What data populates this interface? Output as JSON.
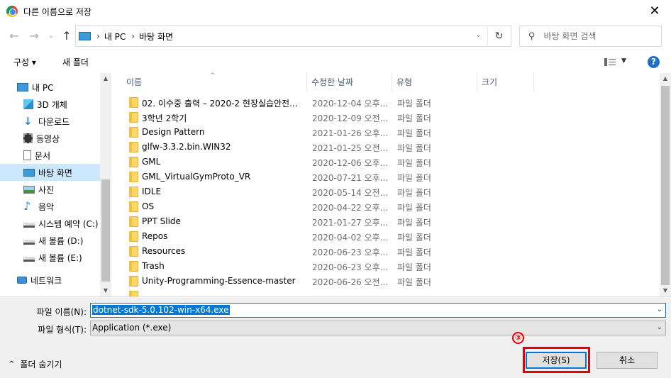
{
  "window": {
    "title": "다른 이름으로 저장",
    "close_glyph": "✕"
  },
  "nav": {
    "back_glyph": "←",
    "forward_glyph": "→",
    "recent_glyph": "⌄",
    "up_glyph": "↑",
    "breadcrumb": [
      "내 PC",
      "바탕 화면"
    ],
    "refresh_glyph": "↻",
    "search_placeholder": "바탕 화면 검색"
  },
  "toolbar": {
    "organize_label": "구성 ▾",
    "new_folder_label": "새 폴더",
    "help_label": "?"
  },
  "sidebar": {
    "items": [
      {
        "label": "내 PC",
        "icon": "pc-icon"
      },
      {
        "label": "3D 개체",
        "icon": "3d-objects-icon"
      },
      {
        "label": "다운로드",
        "icon": "download-icon"
      },
      {
        "label": "동영상",
        "icon": "video-icon"
      },
      {
        "label": "문서",
        "icon": "document-icon"
      },
      {
        "label": "바탕 화면",
        "icon": "desktop-icon",
        "selected": true
      },
      {
        "label": "사진",
        "icon": "pictures-icon"
      },
      {
        "label": "음악",
        "icon": "music-icon"
      },
      {
        "label": "시스템 예약 (C:)",
        "icon": "drive-icon"
      },
      {
        "label": "새 볼륨 (D:)",
        "icon": "drive-icon"
      },
      {
        "label": "새 볼륨 (E:)",
        "icon": "drive-icon"
      },
      {
        "label": "네트워크",
        "icon": "network-icon"
      }
    ]
  },
  "filelist": {
    "columns": [
      "이름",
      "수정한 날짜",
      "유형",
      "크기"
    ],
    "rows": [
      {
        "name": "02. 이수중 출력 – 2020-2 현장실습안전...",
        "date": "2020-12-04 오후...",
        "type": "파일 폴더"
      },
      {
        "name": "3학년 2학기",
        "date": "2020-12-09 오전...",
        "type": "파일 폴더"
      },
      {
        "name": "Design Pattern",
        "date": "2021-01-26 오후...",
        "type": "파일 폴더"
      },
      {
        "name": "glfw-3.3.2.bin.WIN32",
        "date": "2021-01-25 오전...",
        "type": "파일 폴더"
      },
      {
        "name": "GML",
        "date": "2020-12-06 오후...",
        "type": "파일 폴더"
      },
      {
        "name": "GML_VirtualGymProto_VR",
        "date": "2020-07-21 오후...",
        "type": "파일 폴더"
      },
      {
        "name": "IDLE",
        "date": "2020-05-14 오전...",
        "type": "파일 폴더"
      },
      {
        "name": "OS",
        "date": "2020-04-22 오후...",
        "type": "파일 폴더"
      },
      {
        "name": "PPT Slide",
        "date": "2021-01-27 오후...",
        "type": "파일 폴더"
      },
      {
        "name": "Repos",
        "date": "2020-04-02 오후...",
        "type": "파일 폴더"
      },
      {
        "name": "Resources",
        "date": "2020-06-23 오후...",
        "type": "파일 폴더"
      },
      {
        "name": "Trash",
        "date": "2020-06-23 오후...",
        "type": "파일 폴더"
      },
      {
        "name": "Unity-Programming-Essence-master",
        "date": "2020-06-26 오전...",
        "type": "파일 폴더"
      }
    ]
  },
  "form": {
    "filename_label": "파일 이름(N):",
    "filename_value": "dotnet-sdk-5.0.102-win-x64.exe",
    "filetype_label": "파일 형식(T):",
    "filetype_value": "Application (*.exe)",
    "annotation_marker": "③",
    "save_label": "저장(S)",
    "cancel_label": "취소",
    "hide_folders_label": "폴더 숨기기"
  },
  "colors": {
    "selection": "#cce8ff",
    "accent": "#0078d7",
    "annotation": "#e60000"
  }
}
